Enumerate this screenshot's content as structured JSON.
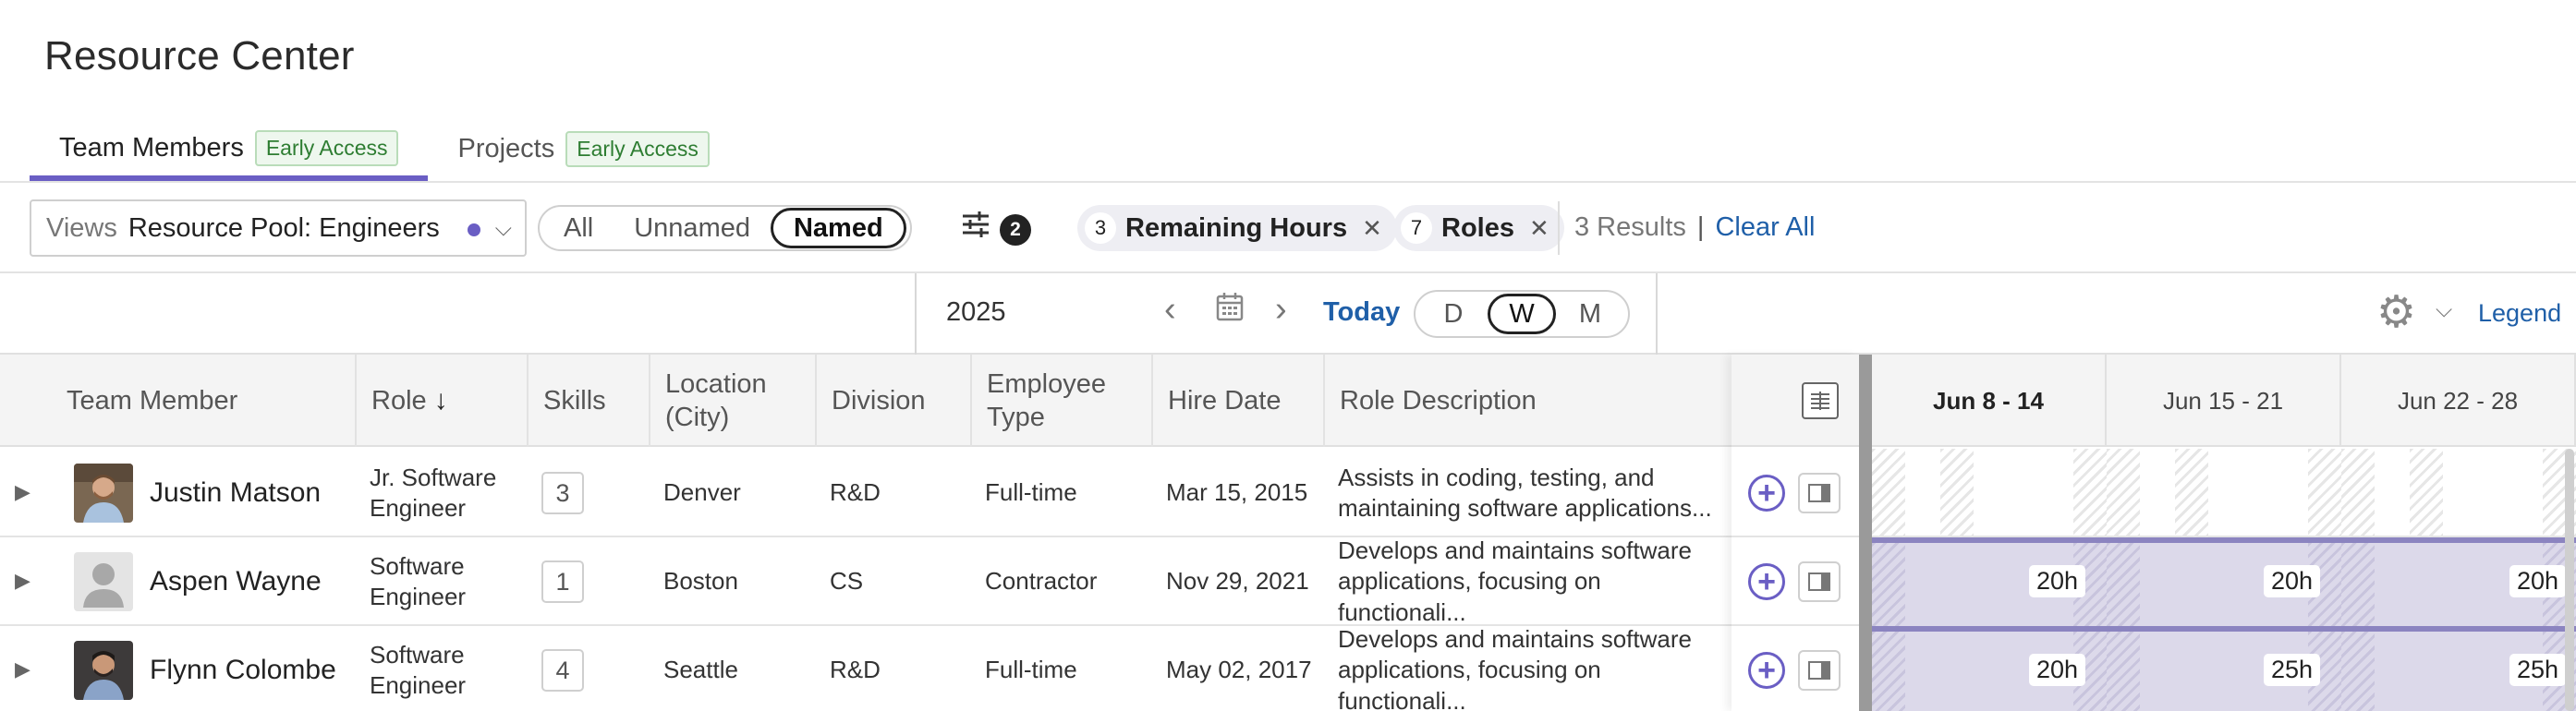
{
  "page": {
    "title": "Resource Center"
  },
  "tabs": [
    {
      "label": "Team Members",
      "badge": "Early Access",
      "active": true
    },
    {
      "label": "Projects",
      "badge": "Early Access",
      "active": false
    }
  ],
  "filters": {
    "views_label": "Views",
    "views_value": "Resource Pool: Engineers",
    "segment": [
      "All",
      "Unnamed",
      "Named"
    ],
    "segment_selected": "Named",
    "filter_count": "2",
    "chips": [
      {
        "count": "3",
        "label": "Remaining Hours"
      },
      {
        "count": "7",
        "label": "Roles"
      }
    ],
    "results": "3 Results",
    "pipe": "|",
    "clear_all": "Clear All"
  },
  "toolbar": {
    "year": "2025",
    "today": "Today",
    "zoom_options": [
      "D",
      "W",
      "M"
    ],
    "zoom_selected": "W",
    "legend": "Legend"
  },
  "grid": {
    "columns": [
      "Team Member",
      "Role",
      "Skills",
      "Location (City)",
      "Division",
      "Employee Type",
      "Hire Date",
      "Role Description"
    ],
    "rows": [
      {
        "name": "Justin Matson",
        "role": "Jr. Software Engineer",
        "skills": "3",
        "city": "Denver",
        "division": "R&D",
        "type": "Full-time",
        "hire": "Mar 15, 2015",
        "desc": "Assists in coding, testing, and maintaining software applications..."
      },
      {
        "name": "Aspen Wayne",
        "role": "Software Engineer",
        "skills": "1",
        "city": "Boston",
        "division": "CS",
        "type": "Contractor",
        "hire": "Nov 29, 2021",
        "desc": "Develops and maintains software applications, focusing on functionali..."
      },
      {
        "name": "Flynn Colombe",
        "role": "Software Engineer",
        "skills": "4",
        "city": "Seattle",
        "division": "R&D",
        "type": "Full-time",
        "hire": "May 02, 2017",
        "desc": "Develops and maintains software applications, focusing on functionali..."
      }
    ]
  },
  "timeline": {
    "weeks": [
      "Jun 8 - 14",
      "Jun 15 - 21",
      "Jun 22 - 28"
    ],
    "rows": [
      {
        "hours": []
      },
      {
        "hours": [
          "20h",
          "20h",
          "20h"
        ]
      },
      {
        "hours": [
          "20h",
          "25h",
          "25h"
        ]
      }
    ]
  },
  "colors": {
    "accent": "#6a5ec4",
    "link": "#1f5fa8",
    "allocation": "#dcd9ea",
    "badge_green": "#2e7d32"
  },
  "icons": [
    "chevron-down-icon",
    "filter-sliders-icon",
    "close-icon",
    "chevron-left-icon",
    "calendar-icon",
    "chevron-right-icon",
    "gear-icon",
    "columns-icon",
    "sort-down-icon",
    "expand-caret-icon",
    "add-circle-icon",
    "side-panel-icon"
  ]
}
